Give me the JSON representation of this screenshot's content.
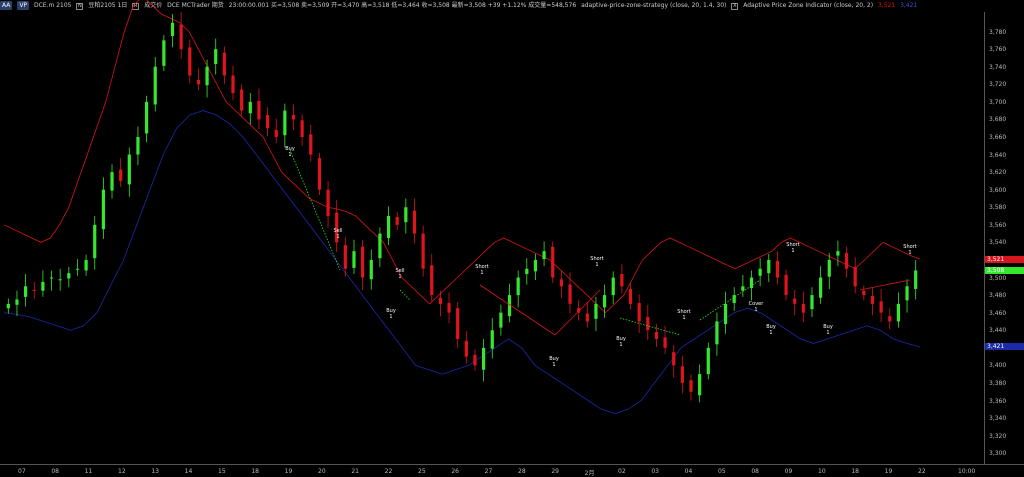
{
  "toolbar": {
    "btn1": "AA",
    "btn2": "VP",
    "symbol": "DCE.m 2105",
    "contract": "豆粕2105 1日",
    "chk_n": "N",
    "btn_r": "R",
    "sub_label": "成交价",
    "exchange": "DCE MCTrader 期货",
    "quote": "23:00:00.001 买=3,508 卖=3,509 开=3,470 高=3,518 低=3,464 收=3,508 最新=3,508 +39 +1.12% 成交量=548,576",
    "strategy": "adaptive-price-zone-strategy (close, 20, 1.4, 30)",
    "chk_x": "X",
    "indicator": "Adaptive Price Zone Indicator  (close, 20, 2)",
    "ind_val1": "3,521",
    "ind_val2": "3,421"
  },
  "colors": {
    "up": "#35e82e",
    "down": "#e0141c",
    "upper_band": "#d8141c",
    "lower_band": "#1a2aa8",
    "trend": "#35e82e"
  },
  "y_axis": {
    "min": 3290,
    "max": 3800,
    "labels": [
      "3,780",
      "3,760",
      "3,740",
      "3,720",
      "3,700",
      "3,680",
      "3,660",
      "3,640",
      "3,620",
      "3,600",
      "3,580",
      "3,560",
      "3,540",
      "3,520",
      "3,500",
      "3,480",
      "3,460",
      "3,440",
      "3,420",
      "3,400",
      "3,380",
      "3,360",
      "3,340",
      "3,320",
      "3,300"
    ],
    "tags": [
      {
        "text": "3,521",
        "value": 3521,
        "color": "#d8141c"
      },
      {
        "text": "3,508",
        "value": 3508,
        "color": "#35e82e"
      },
      {
        "text": "3,421",
        "value": 3421,
        "color": "#1a2aa8"
      }
    ]
  },
  "x_axis": {
    "labels": [
      "07",
      "08",
      "11",
      "12",
      "13",
      "14",
      "15",
      "18",
      "19",
      "20",
      "21",
      "22",
      "25",
      "26",
      "27",
      "28",
      "29",
      "2月",
      "02",
      "03",
      "04",
      "05",
      "08",
      "09",
      "10",
      "18",
      "19",
      "22",
      "10:00"
    ]
  },
  "chart_data": {
    "type": "candlestick",
    "series": {
      "close": [
        3470,
        3475,
        3490,
        3485,
        3495,
        3500,
        3498,
        3505,
        3510,
        3520,
        3560,
        3600,
        3620,
        3610,
        3640,
        3660,
        3700,
        3740,
        3770,
        3790,
        3760,
        3730,
        3720,
        3740,
        3760,
        3730,
        3710,
        3690,
        3700,
        3680,
        3670,
        3660,
        3690,
        3680,
        3660,
        3640,
        3600,
        3570,
        3540,
        3510,
        3530,
        3500,
        3520,
        3550,
        3570,
        3560,
        3580,
        3550,
        3510,
        3480,
        3470,
        3460,
        3430,
        3410,
        3400,
        3420,
        3440,
        3460,
        3480,
        3500,
        3510,
        3520,
        3530,
        3500,
        3490,
        3470,
        3460,
        3450,
        3470,
        3480,
        3500,
        3490,
        3470,
        3450,
        3440,
        3430,
        3420,
        3400,
        3380,
        3370,
        3390,
        3420,
        3450,
        3470,
        3480,
        3490,
        3500,
        3510,
        3520,
        3500,
        3480,
        3470,
        3460,
        3480,
        3500,
        3520,
        3530,
        3510,
        3490,
        3480,
        3470,
        3460,
        3450,
        3470,
        3490,
        3508
      ],
      "upper_band": [
        3560,
        3555,
        3550,
        3545,
        3540,
        3545,
        3560,
        3580,
        3610,
        3640,
        3670,
        3700,
        3740,
        3780,
        3810,
        3820,
        3810,
        3800,
        3795,
        3790,
        3780,
        3760,
        3740,
        3720,
        3700,
        3690,
        3680,
        3670,
        3660,
        3640,
        3620,
        3610,
        3600,
        3590,
        3585,
        3580,
        3578,
        3575,
        3570,
        3560,
        3550,
        3540,
        3520,
        3500,
        3490,
        3480,
        3470,
        3480,
        3490,
        3500,
        3510,
        3520,
        3530,
        3540,
        3545,
        3540,
        3535,
        3530,
        3525,
        3520,
        3510,
        3500,
        3490,
        3480,
        3470,
        3460,
        3470,
        3480,
        3500,
        3520,
        3530,
        3540,
        3545,
        3540,
        3535,
        3530,
        3525,
        3520,
        3515,
        3510,
        3515,
        3520,
        3525,
        3530,
        3540,
        3545,
        3540,
        3535,
        3530,
        3525,
        3520,
        3515,
        3510,
        3520,
        3530,
        3540,
        3535,
        3530,
        3525,
        3521
      ],
      "lower_band": [
        3460,
        3458,
        3455,
        3450,
        3445,
        3440,
        3445,
        3460,
        3490,
        3520,
        3560,
        3600,
        3640,
        3670,
        3685,
        3690,
        3685,
        3675,
        3660,
        3640,
        3620,
        3600,
        3580,
        3560,
        3540,
        3520,
        3500,
        3480,
        3460,
        3440,
        3420,
        3400,
        3395,
        3390,
        3395,
        3400,
        3410,
        3420,
        3430,
        3420,
        3400,
        3390,
        3380,
        3370,
        3360,
        3350,
        3345,
        3350,
        3360,
        3380,
        3400,
        3420,
        3430,
        3440,
        3450,
        3460,
        3465,
        3460,
        3450,
        3440,
        3430,
        3425,
        3430,
        3435,
        3440,
        3445,
        3440,
        3430,
        3425,
        3421
      ]
    },
    "signals": [
      {
        "label": "Buy",
        "qty": "1",
        "type": "buy"
      },
      {
        "label": "Sell",
        "qty": "1",
        "type": "sell"
      },
      {
        "label": "Sell",
        "qty": "1",
        "type": "sell"
      },
      {
        "label": "Buy",
        "qty": "1",
        "type": "buy"
      },
      {
        "label": "Short",
        "qty": "1",
        "type": "short"
      },
      {
        "label": "Buy",
        "qty": "1",
        "type": "buy"
      },
      {
        "label": "Short",
        "qty": "1",
        "type": "short"
      },
      {
        "label": "Buy",
        "qty": "1",
        "type": "buy"
      },
      {
        "label": "Short",
        "qty": "1",
        "type": "short"
      },
      {
        "label": "Cover",
        "qty": "1",
        "type": "cover"
      },
      {
        "label": "Buy",
        "qty": "1",
        "type": "buy"
      },
      {
        "label": "Short",
        "qty": "1",
        "type": "short"
      },
      {
        "label": "Buy",
        "qty": "1",
        "type": "buy"
      },
      {
        "label": "Short",
        "qty": "1",
        "type": "short"
      }
    ]
  }
}
